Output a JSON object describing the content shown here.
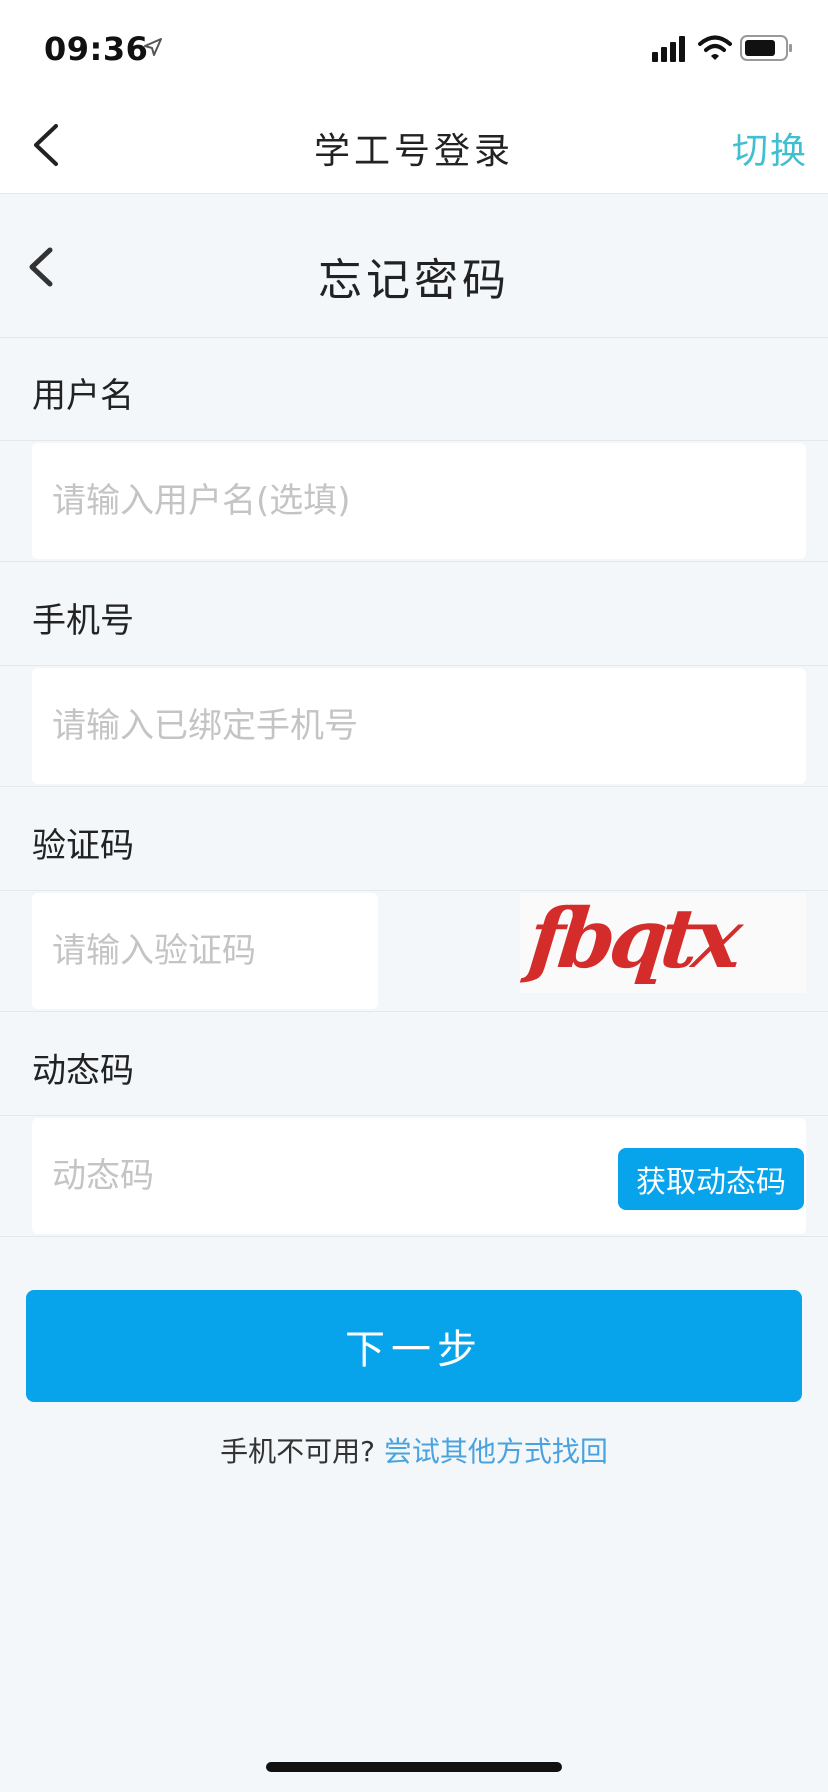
{
  "status_bar": {
    "time": "09:36",
    "icons": [
      "location-arrow-icon",
      "signal-icon",
      "wifi-icon",
      "battery-icon"
    ]
  },
  "nav": {
    "back_icon": "chevron-left-icon",
    "title": "学工号登录",
    "switch_label": "切换"
  },
  "page": {
    "back_icon": "chevron-left-icon",
    "title": "忘记密码"
  },
  "form": {
    "username": {
      "label": "用户名",
      "value": "",
      "placeholder": "请输入用户名(选填)"
    },
    "phone": {
      "label": "手机号",
      "value": "",
      "placeholder": "请输入已绑定手机号"
    },
    "captcha": {
      "label": "验证码",
      "value": "",
      "placeholder": "请输入验证码",
      "image_text": "fbqtx"
    },
    "otp": {
      "label": "动态码",
      "value": "",
      "placeholder": "动态码",
      "button_label": "获取动态码"
    }
  },
  "actions": {
    "next_label": "下一步",
    "alt_prefix": "手机不可用?",
    "alt_link": "尝试其他方式找回"
  },
  "colors": {
    "accent_blue": "#07a4ec",
    "switch_teal": "#3fbfd0",
    "link_blue": "#4aa3df",
    "captcha_red": "#d42b2b",
    "background": "#f3f7fa"
  }
}
